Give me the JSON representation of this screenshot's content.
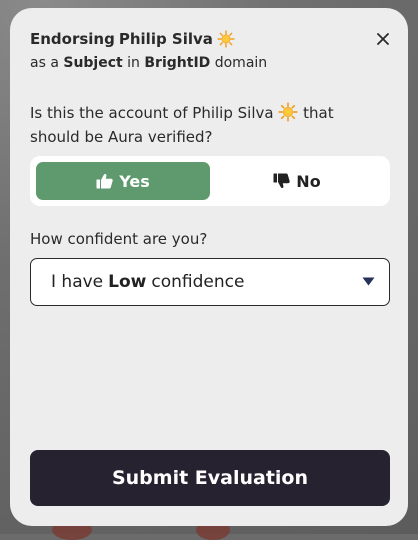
{
  "modal": {
    "title_prefix": "Endorsing",
    "name": "Philip Silva",
    "subtitle": {
      "as": "as a",
      "role": "Subject",
      "in": "in",
      "domain": "BrightID",
      "suffix": "domain"
    },
    "close_icon": "close-icon",
    "question": "Is this the account of Philip Silva",
    "question_end": "that should be Aura verified?",
    "options": {
      "yes": "Yes",
      "no": "No",
      "selected": "Yes"
    },
    "confidence_label": "How confident are you?",
    "confidence": {
      "prefix": "I have",
      "level": "Low",
      "suffix": "confidence"
    },
    "submit_label": "Submit Evaluation"
  },
  "colors": {
    "yes_bg": "#5f9a6e",
    "submit_bg": "#26222f",
    "modal_bg": "#ededed"
  }
}
